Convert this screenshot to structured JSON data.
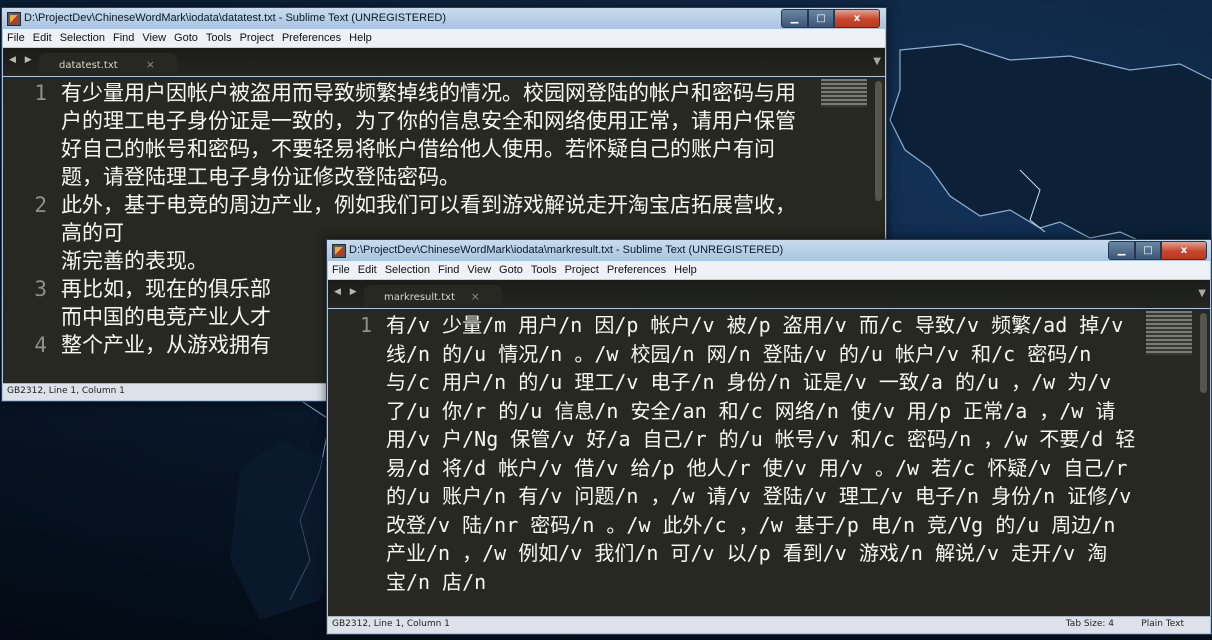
{
  "win1": {
    "title": "D:\\ProjectDev\\ChineseWordMark\\iodata\\datatest.txt - Sublime Text (UNREGISTERED)",
    "tab": "datatest.txt",
    "lines": [
      {
        "num": "1",
        "text": "有少量用户因帐户被盗用而导致频繁掉线的情况。校园网登陆的帐户和密码与用户的理工电子身份证是一致的，为了你的信息安全和网络使用正常，请用户保管好自己的帐号和密码，不要轻易将帐户借给他人使用。若怀疑自己的账户有问题，请登陆理工电子身份证修改登陆密码。"
      },
      {
        "num": "2",
        "text": "此外，基于电竞的周边产业，例如我们可以看到游戏解说走开淘宝店拓展营收，高的可"
      },
      {
        "num": "",
        "text": "渐完善的表现。"
      },
      {
        "num": "3",
        "text": "再比如，现在的俱乐部"
      },
      {
        "num": "",
        "text": "而中国的电竞产业人才"
      },
      {
        "num": "4",
        "text": "整个产业，从游戏拥有"
      }
    ],
    "status": "GB2312, Line 1, Column 1"
  },
  "win2": {
    "title": "D:\\ProjectDev\\ChineseWordMark\\iodata\\markresult.txt - Sublime Text (UNREGISTERED)",
    "tab": "markresult.txt",
    "lines": [
      {
        "num": "1",
        "text": "有/v 少量/m 用户/n 因/p 帐户/v 被/p 盗用/v 而/c 导致/v 频繁/ad 掉/v 线/n 的/u 情况/n 。/w 校园/n 网/n 登陆/v 的/u 帐户/v 和/c 密码/n 与/c 用户/n 的/u 理工/v 电子/n 身份/n 证是/v 一致/a 的/u ，/w 为/v 了/u 你/r 的/u 信息/n 安全/an 和/c 网络/n 使/v 用/p 正常/a ，/w 请用/v 户/Ng 保管/v 好/a 自己/r 的/u 帐号/v 和/c 密码/n ，/w 不要/d 轻易/d 将/d 帐户/v 借/v 给/p 他人/r 使/v 用/v 。/w 若/c 怀疑/v 自己/r 的/u 账户/n 有/v 问题/n ，/w 请/v 登陆/v 理工/v 电子/n 身份/n 证修/v 改登/v 陆/nr 密码/n 。/w 此外/c ，/w 基于/p 电/n 竞/Vg 的/u 周边/n 产业/n ，/w 例如/v 我们/n 可/v 以/p 看到/v 游戏/n 解说/v 走开/v 淘宝/n 店/n"
      }
    ],
    "status": "GB2312, Line 1, Column 1",
    "tab_size": "Tab Size: 4",
    "syntax": "Plain Text"
  },
  "menu": [
    "File",
    "Edit",
    "Selection",
    "Find",
    "View",
    "Goto",
    "Tools",
    "Project",
    "Preferences",
    "Help"
  ],
  "controls": {
    "min": "▁",
    "max": "□",
    "close": "x"
  },
  "tab_close": "×",
  "nav_arrows": "◀ ▶",
  "dropdown": "▼",
  "colors": {
    "editor_bg": "#272822",
    "editor_fg": "#f8f8f2",
    "gutter_fg": "#90908a",
    "titlebar": "#b7d0e8"
  }
}
